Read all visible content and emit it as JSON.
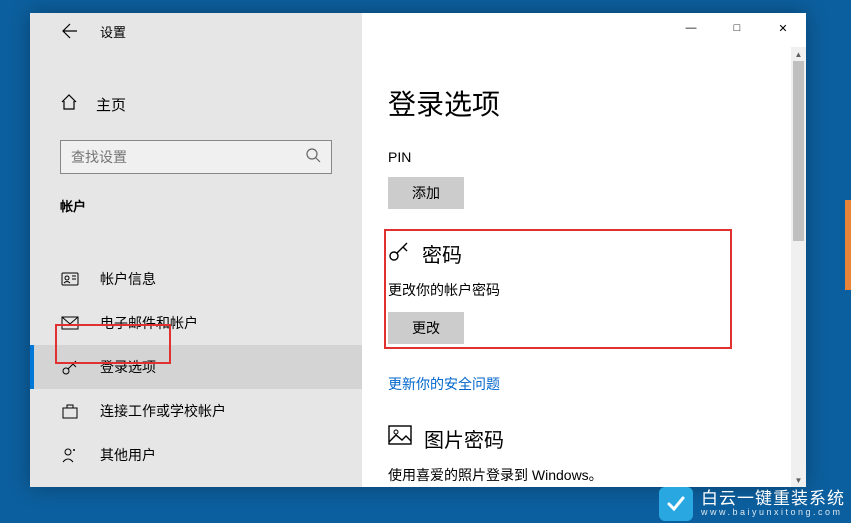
{
  "window": {
    "title": "设置",
    "controls": {
      "min": "—",
      "max": "□",
      "close": "✕"
    }
  },
  "sidebar": {
    "home": "主页",
    "search_placeholder": "查找设置",
    "category": "帐户",
    "items": [
      {
        "icon": "person-card-icon",
        "label": "帐户信息"
      },
      {
        "icon": "mail-icon",
        "label": "电子邮件和帐户"
      },
      {
        "icon": "key-icon",
        "label": "登录选项"
      },
      {
        "icon": "briefcase-icon",
        "label": "连接工作或学校帐户"
      },
      {
        "icon": "people-icon",
        "label": "其他用户"
      }
    ]
  },
  "content": {
    "title": "登录选项",
    "pin": {
      "label": "PIN",
      "button": "添加"
    },
    "password": {
      "title": "密码",
      "desc": "更改你的帐户密码",
      "button": "更改"
    },
    "security_link": "更新你的安全问题",
    "picture_password": {
      "title": "图片密码",
      "desc": "使用喜爱的照片登录到 Windows。"
    }
  },
  "watermark": {
    "main": "白云一键重装系统",
    "sub": "www.baiyunxitong.com"
  }
}
